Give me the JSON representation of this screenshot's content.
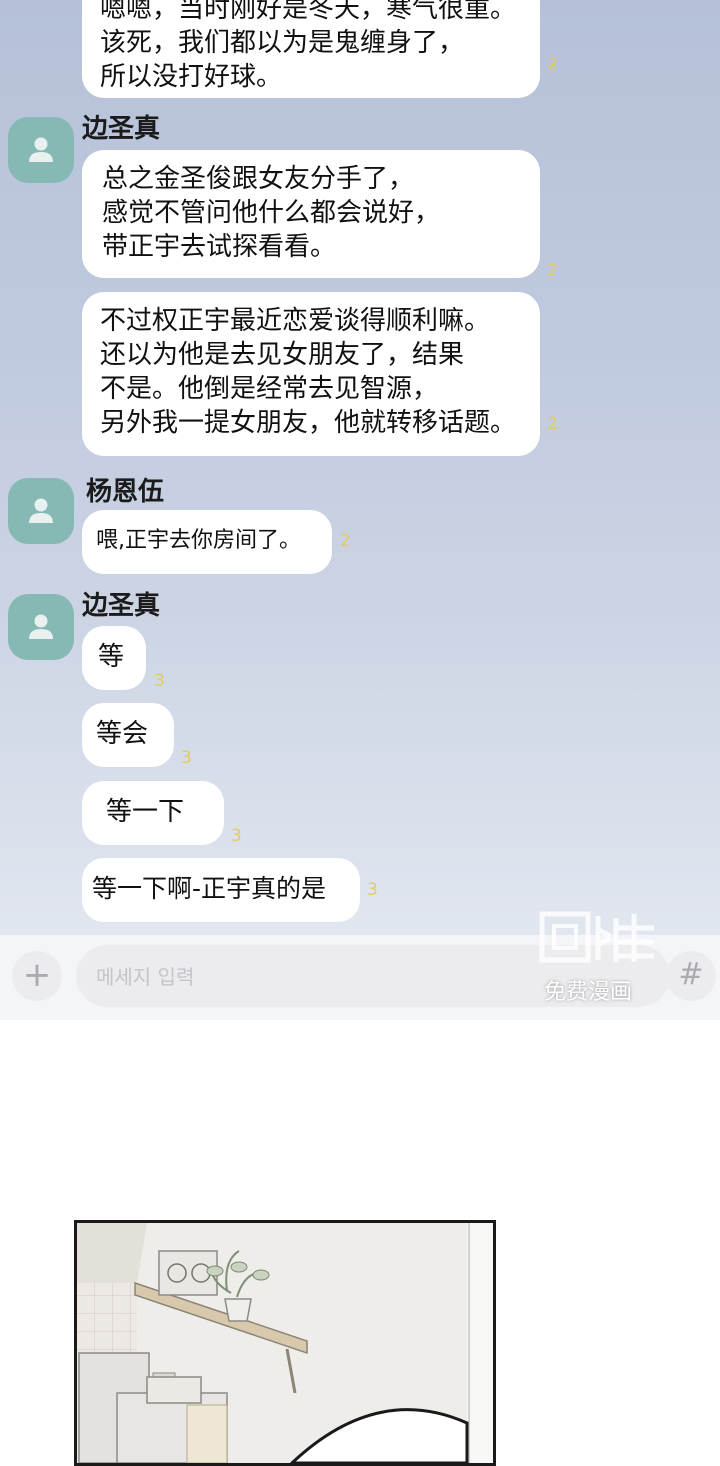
{
  "messages": {
    "top": {
      "lines": [
        "嗯嗯，当时刚好是冬天，寒气很重。",
        "该死，我们都以为是鬼缠身了，",
        "所以没打好球。"
      ],
      "read": "2"
    },
    "g1": {
      "sender": "边圣真",
      "b1": {
        "lines": [
          "总之金圣俊跟女友分手了，",
          "感觉不管问他什么都会说好，",
          "带正宇去试探看看。"
        ],
        "read": "2"
      },
      "b2": {
        "lines": [
          "不过权正宇最近恋爱谈得顺利嘛。",
          "还以为他是去见女朋友了，结果",
          "不是。他倒是经常去见智源，",
          "另外我一提女朋友，他就转移话题。"
        ],
        "read": "2"
      }
    },
    "g2": {
      "sender": "杨恩伍",
      "b1": {
        "text": "喂,正宇去你房间了。",
        "read": "2"
      }
    },
    "g3": {
      "sender": "边圣真",
      "b1": {
        "text": "等",
        "read": "3"
      },
      "b2": {
        "text": "等会",
        "read": "3"
      },
      "b3": {
        "text": "等一下",
        "read": "3"
      },
      "b4": {
        "text": "等一下啊-正宇真的是",
        "read": "3"
      }
    }
  },
  "input": {
    "placeholder": "메세지 입력",
    "plus_icon": "+",
    "hash_icon": "#"
  },
  "watermark": {
    "logo": "画涯",
    "text": "免费漫画"
  },
  "colors": {
    "avatar": "#86b9b4",
    "read_count": "#e2cc5e",
    "bubble": "#ffffff"
  }
}
